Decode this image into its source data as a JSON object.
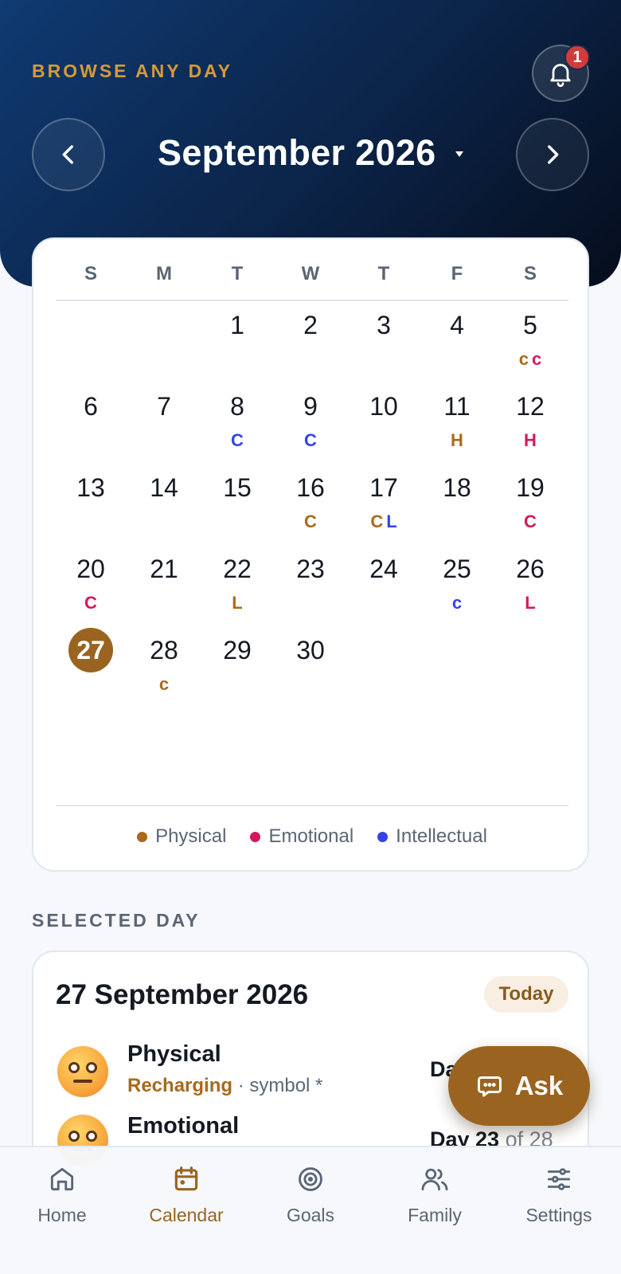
{
  "header": {
    "eyebrow": "BROWSE ANY DAY",
    "month_title": "September 2026",
    "notification_count": "1"
  },
  "calendar": {
    "weekdays": [
      "S",
      "M",
      "T",
      "W",
      "T",
      "F",
      "S"
    ],
    "days": [
      "1",
      "2",
      "3",
      "4",
      "5",
      "6",
      "7",
      "8",
      "9",
      "10",
      "11",
      "12",
      "13",
      "14",
      "15",
      "16",
      "17",
      "18",
      "19",
      "20",
      "21",
      "22",
      "23",
      "24",
      "25",
      "26",
      "27",
      "28",
      "29",
      "30"
    ],
    "today": "27",
    "markers": [
      {
        "day": "5",
        "items": [
          {
            "letter": "c",
            "type": "physical"
          },
          {
            "letter": "c",
            "type": "emotional"
          }
        ]
      },
      {
        "day": "8",
        "items": [
          {
            "letter": "C",
            "type": "intellectual"
          }
        ]
      },
      {
        "day": "9",
        "items": [
          {
            "letter": "C",
            "type": "intellectual"
          }
        ]
      },
      {
        "day": "11",
        "items": [
          {
            "letter": "H",
            "type": "physical"
          }
        ]
      },
      {
        "day": "12",
        "items": [
          {
            "letter": "H",
            "type": "emotional"
          }
        ]
      },
      {
        "day": "16",
        "items": [
          {
            "letter": "C",
            "type": "physical"
          }
        ]
      },
      {
        "day": "17",
        "items": [
          {
            "letter": "C",
            "type": "physical"
          },
          {
            "letter": "L",
            "type": "intellectual"
          }
        ]
      },
      {
        "day": "19",
        "items": [
          {
            "letter": "C",
            "type": "emotional"
          }
        ]
      },
      {
        "day": "20",
        "items": [
          {
            "letter": "C",
            "type": "emotional"
          }
        ]
      },
      {
        "day": "22",
        "items": [
          {
            "letter": "L",
            "type": "physical"
          }
        ]
      },
      {
        "day": "25",
        "items": [
          {
            "letter": "c",
            "type": "intellectual"
          }
        ]
      },
      {
        "day": "26",
        "items": [
          {
            "letter": "L",
            "type": "emotional"
          }
        ]
      },
      {
        "day": "28",
        "items": [
          {
            "letter": "c",
            "type": "physical"
          }
        ]
      }
    ],
    "legend": [
      {
        "label": "Physical",
        "color": "#a86a1c"
      },
      {
        "label": "Emotional",
        "color": "#d3195e"
      },
      {
        "label": "Intellectual",
        "color": "#3444e4"
      }
    ],
    "colors": {
      "physical": "#a86a1c",
      "emotional": "#d3195e",
      "intellectual": "#3444e4"
    }
  },
  "selected_day": {
    "section_label": "SELECTED DAY",
    "date_title": "27 September 2026",
    "today_pill": "Today",
    "rows": [
      {
        "label": "Physical",
        "status": "Recharging",
        "sub": " · symbol *",
        "day_prefix": "Da",
        "day_rest": ""
      },
      {
        "label": "Emotional",
        "status": "",
        "sub": "",
        "day_prefix": "Day 23",
        "day_rest": " of 28"
      }
    ]
  },
  "ask_button": {
    "label": "Ask"
  },
  "tabbar": {
    "tabs": [
      {
        "label": "Home",
        "icon": "home-icon"
      },
      {
        "label": "Calendar",
        "icon": "calendar-icon"
      },
      {
        "label": "Goals",
        "icon": "target-icon"
      },
      {
        "label": "Family",
        "icon": "people-icon"
      },
      {
        "label": "Settings",
        "icon": "sliders-icon"
      }
    ],
    "active": "Calendar"
  }
}
